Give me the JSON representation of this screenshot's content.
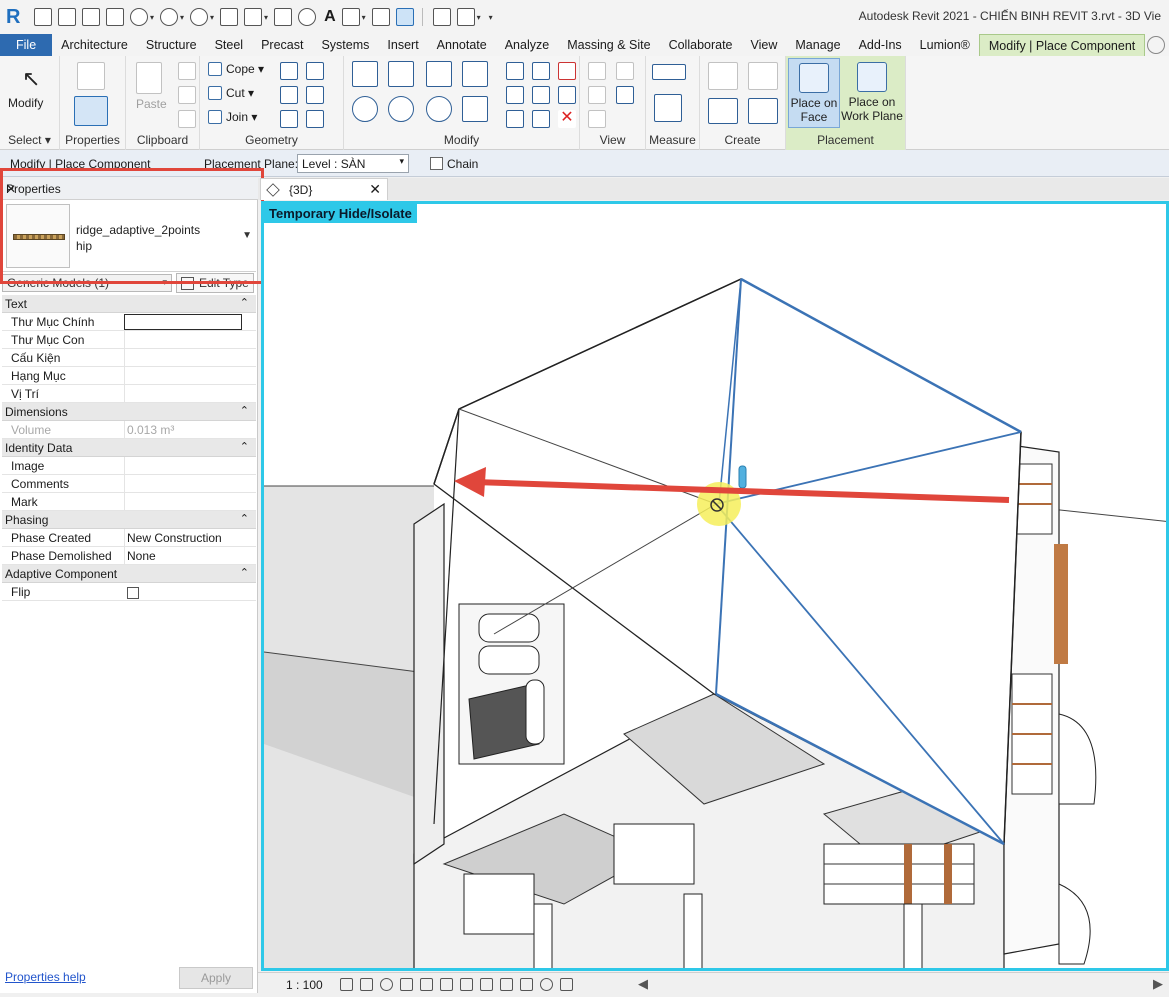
{
  "window": {
    "app_letter": "R",
    "title": "Autodesk Revit 2021 - CHIẾN BINH REVIT 3.rvt - 3D Vie",
    "qat_text_tool": "A"
  },
  "ribbon_tabs": [
    "File",
    "Architecture",
    "Structure",
    "Steel",
    "Precast",
    "Systems",
    "Insert",
    "Annotate",
    "Analyze",
    "Massing & Site",
    "Collaborate",
    "View",
    "Manage",
    "Add-Ins",
    "Lumion®",
    "Modify | Place Component"
  ],
  "ribbon": {
    "select": {
      "modify_label": "Modify",
      "panel_label": "Select ▾"
    },
    "properties": {
      "panel_label": "Properties"
    },
    "clipboard": {
      "paste_label": "Paste",
      "panel_label": "Clipboard"
    },
    "geometry": {
      "cope_label": "Cope ▾",
      "cut_label": "Cut ▾",
      "join_label": "Join ▾",
      "panel_label": "Geometry"
    },
    "modify": {
      "panel_label": "Modify"
    },
    "view": {
      "panel_label": "View"
    },
    "measure": {
      "panel_label": "Measure"
    },
    "create": {
      "panel_label": "Create"
    },
    "placement": {
      "face_line1": "Place on",
      "face_line2": "Face",
      "plane_line1": "Place on",
      "plane_line2": "Work Plane",
      "panel_label": "Placement"
    }
  },
  "options_bar": {
    "context": "Modify | Place Component",
    "placement_plane_label": "Placement Plane:",
    "placement_plane_value": "Level : SÀN",
    "chain_label": "Chain"
  },
  "properties": {
    "title": "Properties",
    "type_name_line1": "ridge_adaptive_2points",
    "type_name_line2": "hip",
    "filter": "Generic Models (1)",
    "edit_type": "Edit Type",
    "groups": [
      {
        "name": "Text",
        "rows": [
          {
            "key": "Thư Mục Chính",
            "value": ""
          },
          {
            "key": "Thư Mục Con",
            "value": ""
          },
          {
            "key": "Cấu Kiện",
            "value": ""
          },
          {
            "key": "Hạng Mục",
            "value": ""
          },
          {
            "key": "Vị Trí",
            "value": ""
          }
        ]
      },
      {
        "name": "Dimensions",
        "rows": [
          {
            "key": "Volume",
            "value": "0.013 m³"
          }
        ]
      },
      {
        "name": "Identity Data",
        "rows": [
          {
            "key": "Image",
            "value": ""
          },
          {
            "key": "Comments",
            "value": ""
          },
          {
            "key": "Mark",
            "value": ""
          }
        ]
      },
      {
        "name": "Phasing",
        "rows": [
          {
            "key": "Phase Created",
            "value": "New Construction"
          },
          {
            "key": "Phase Demolished",
            "value": "None"
          }
        ]
      },
      {
        "name": "Adaptive Component",
        "rows": [
          {
            "key": "Flip",
            "value": ""
          }
        ]
      }
    ],
    "help_link": "Properties help",
    "apply": "Apply",
    "collapse_glyph": "⌃"
  },
  "view": {
    "tab_name": "{3D}",
    "banner": "Temporary Hide/Isolate"
  },
  "status": {
    "scale": "1 : 100"
  },
  "colors": {
    "file_tab": "#2d6ab0",
    "context_tab": "#dbecc6",
    "isolate_border": "#2ec8e8",
    "annotation_red": "#e0463b",
    "model_line_blue": "#3b73b5"
  }
}
